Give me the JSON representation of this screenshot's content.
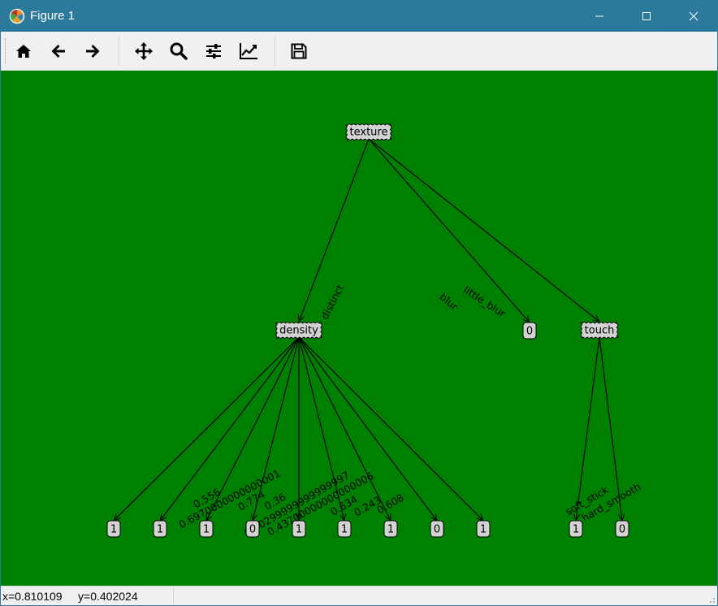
{
  "window": {
    "title": "Figure 1",
    "icons": [
      "matplotlib-logo-icon",
      "minimize-icon",
      "maximize-icon",
      "close-icon"
    ]
  },
  "toolbar": {
    "buttons": [
      {
        "name": "home",
        "icon": "home-icon"
      },
      {
        "name": "back",
        "icon": "arrow-left-icon"
      },
      {
        "name": "forward",
        "icon": "arrow-right-icon"
      },
      {
        "name": "pan",
        "icon": "move-arrows-icon"
      },
      {
        "name": "zoom",
        "icon": "magnifier-icon"
      },
      {
        "name": "configure-subplots",
        "icon": "sliders-icon"
      },
      {
        "name": "edit-axis",
        "icon": "line-chart-icon"
      },
      {
        "name": "save",
        "icon": "floppy-disk-icon"
      }
    ]
  },
  "figure": {
    "background": "#008000",
    "node_fill": "#d3d3d3",
    "leaf_fill": "#d3d3d3"
  },
  "tree": {
    "decision_nodes": [
      {
        "id": "texture",
        "label": "texture"
      },
      {
        "id": "density",
        "label": "density"
      },
      {
        "id": "touch",
        "label": "touch"
      }
    ],
    "leaf_nodes": [
      {
        "id": "d1",
        "label": "1"
      },
      {
        "id": "d2",
        "label": "1"
      },
      {
        "id": "d3",
        "label": "1"
      },
      {
        "id": "d4",
        "label": "0"
      },
      {
        "id": "d5",
        "label": "1"
      },
      {
        "id": "d6",
        "label": "1"
      },
      {
        "id": "d7",
        "label": "1"
      },
      {
        "id": "d8",
        "label": "0"
      },
      {
        "id": "d9",
        "label": "1"
      },
      {
        "id": "tblur",
        "label": "0"
      },
      {
        "id": "c1",
        "label": "1"
      },
      {
        "id": "c2",
        "label": "0"
      }
    ],
    "edges": [
      {
        "from": "texture",
        "to": "density",
        "label": "distinct"
      },
      {
        "from": "texture",
        "to": "tblur",
        "label": "blur"
      },
      {
        "from": "texture",
        "to": "touch",
        "label": "little_blur"
      },
      {
        "from": "density",
        "to": "d1",
        "label": "0.556"
      },
      {
        "from": "density",
        "to": "d2",
        "label": "0.6970000000000001"
      },
      {
        "from": "density",
        "to": "d3",
        "label": "0.774"
      },
      {
        "from": "density",
        "to": "d4",
        "label": "0.36"
      },
      {
        "from": "density",
        "to": "d5",
        "label": "0.40299999999999997"
      },
      {
        "from": "density",
        "to": "d6",
        "label": "0.43700000000000006"
      },
      {
        "from": "density",
        "to": "d7",
        "label": "0.634"
      },
      {
        "from": "density",
        "to": "d8",
        "label": "0.243"
      },
      {
        "from": "density",
        "to": "d9",
        "label": "0.608"
      },
      {
        "from": "touch",
        "to": "c1",
        "label": "soft_stick"
      },
      {
        "from": "touch",
        "to": "c2",
        "label": "hard_smooth"
      }
    ]
  },
  "status": {
    "x_label": "x=0.810109",
    "y_label": "y=0.402024"
  }
}
